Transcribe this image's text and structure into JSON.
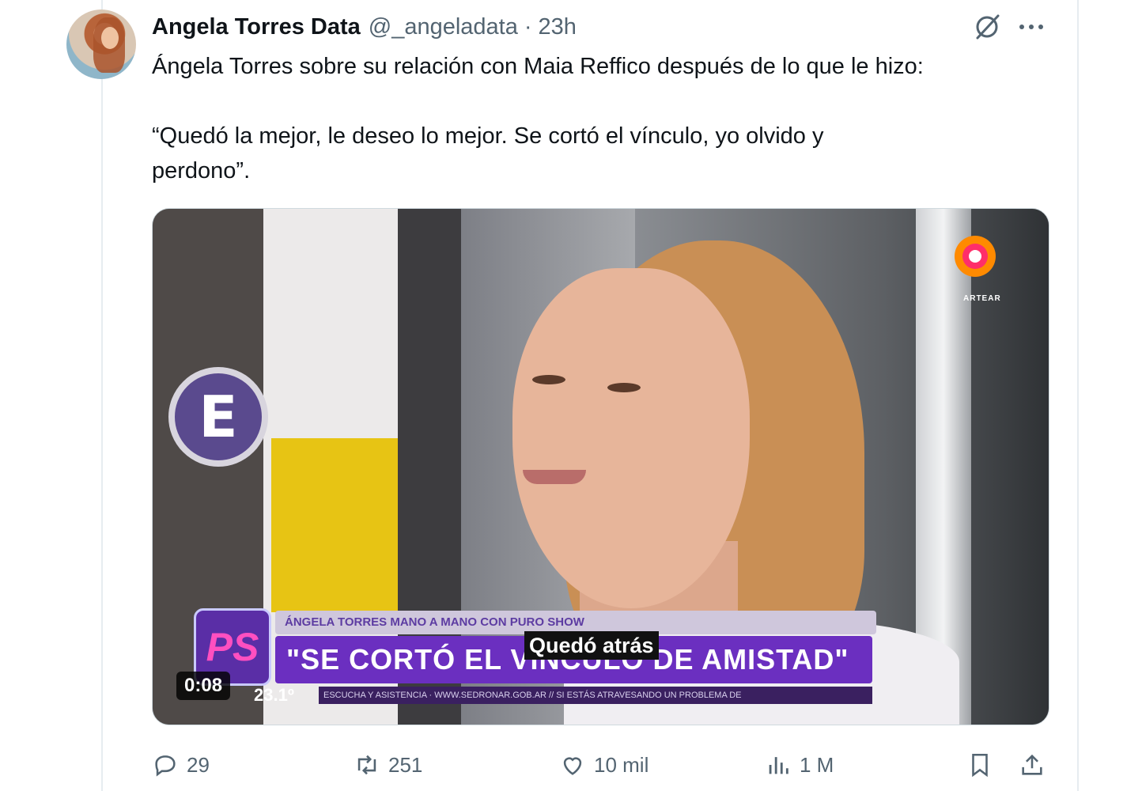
{
  "tweet": {
    "display_name": "Angela Torres Data",
    "handle": "@_angeladata",
    "separator": "·",
    "time": "23h",
    "text_line1": "Ángela Torres sobre su relación con Maia Reffico después de lo que le hizo:",
    "text_line2": "“Quedó la mejor, le deseo lo mejor. Se cortó el vínculo, yo olvido y",
    "text_line3": "perdono”."
  },
  "video": {
    "sign_letter": "E",
    "channel_name": "ARTEAR",
    "show_logo": "PS",
    "lower_third_top": "ÁNGELA TORRES MANO A MANO CON PURO SHOW",
    "lower_third_main": "\"SE CORTÓ EL VÍNCULO DE AMISTAD\"",
    "ticker": "ESCUCHA Y ASISTENCIA · WWW.SEDRONAR.GOB.AR // SI ESTÁS ATRAVESANDO UN PROBLEMA DE",
    "temperature": "23.1º",
    "subtitle": "Quedó atrás",
    "timer": "0:08"
  },
  "actions": {
    "reply_count": "29",
    "retweet_count": "251",
    "like_count": "10 mil",
    "views_count": "1 M"
  },
  "icons": {
    "reply": "reply-icon",
    "retweet": "retweet-icon",
    "like": "heart-icon",
    "views": "views-icon",
    "bookmark": "bookmark-icon",
    "share": "share-icon",
    "grok": "grok-icon",
    "more": "more-icon"
  },
  "colors": {
    "secondary_text": "#536471",
    "lower_third": "#6b2fc0"
  }
}
